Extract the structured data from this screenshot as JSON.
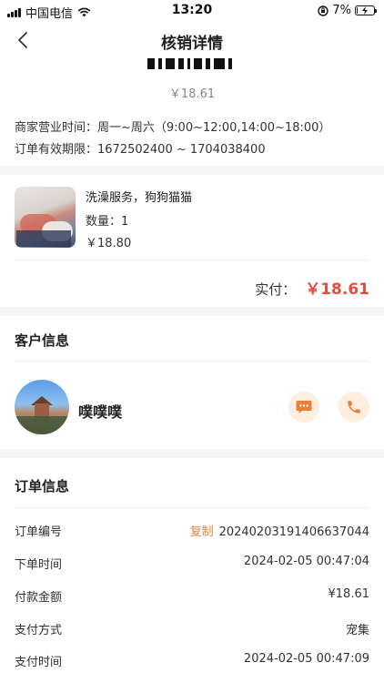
{
  "status_bar": {
    "carrier": "中国电信",
    "time": "13:20",
    "battery": "7%",
    "battery_level": 0.07
  },
  "nav": {
    "title": "核销详情"
  },
  "top": {
    "price": "￥18.61",
    "hours_label": "商家营业时间：",
    "hours_value": "周一~周六（9:00~12:00,14:00~18:00）",
    "validity_label": "订单有效期限：",
    "validity_value": "1672502400 ~ 1704038400"
  },
  "product": {
    "name": "洗澡服务，狗狗猫猫",
    "quantity": "数量：1",
    "price": "￥18.80",
    "paid_label": "实付：",
    "paid_value": "￥18.61"
  },
  "customer": {
    "section_title": "客户信息",
    "name": "噗噗噗",
    "message_icon": "chat-bubble-icon",
    "phone_icon": "phone-icon",
    "accent_color": "#e8803a"
  },
  "order": {
    "section_title": "订单信息",
    "rows": [
      {
        "label": "订单编号",
        "value": "20240203191406637044"
      },
      {
        "label": "下单时间",
        "value": "2024-02-05 00:47:04"
      },
      {
        "label": "付款金额",
        "value": "¥18.61"
      },
      {
        "label": "支付方式",
        "value": "宠集"
      },
      {
        "label": "支付时间",
        "value": "2024-02-05 00:47:09"
      }
    ],
    "copy_label": "复制"
  },
  "colors": {
    "price_red": "#e84c3d",
    "accent_orange": "#e8803a"
  }
}
